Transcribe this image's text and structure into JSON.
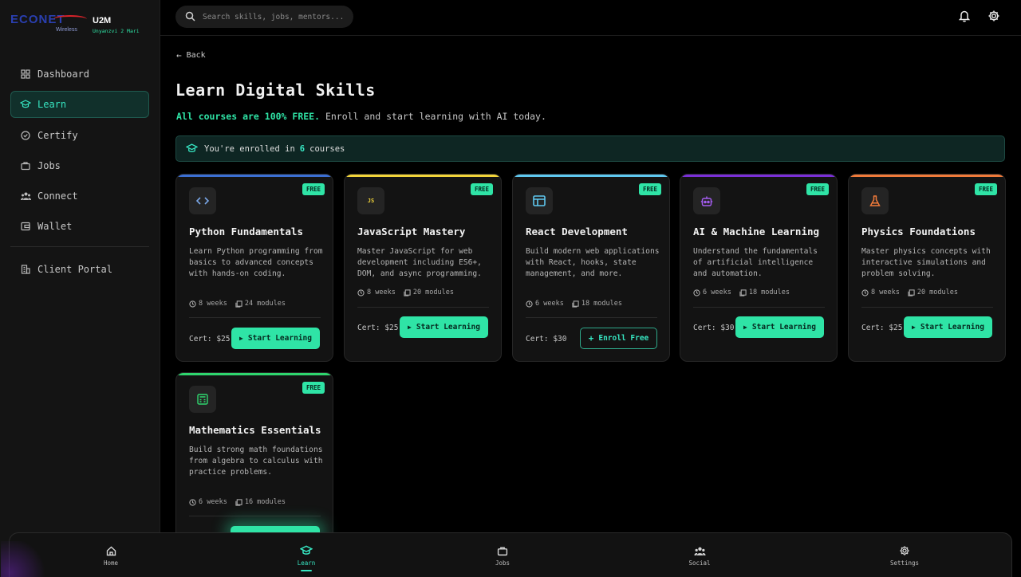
{
  "brand": {
    "logo": "ECONET",
    "logo_sub": "Wireless",
    "app": "U2M",
    "tagline": "Unyanzvi 2 Mari"
  },
  "search": {
    "placeholder": "Search skills, jobs, mentors..."
  },
  "sidebar": {
    "items": [
      {
        "label": "Dashboard",
        "icon": "dashboard-icon"
      },
      {
        "label": "Learn",
        "icon": "graduation-cap-icon",
        "active": true
      },
      {
        "label": "Certify",
        "icon": "badge-check-icon"
      },
      {
        "label": "Jobs",
        "icon": "briefcase-icon"
      },
      {
        "label": "Connect",
        "icon": "users-icon"
      },
      {
        "label": "Wallet",
        "icon": "wallet-icon"
      }
    ],
    "footer_item": {
      "label": "Client Portal",
      "icon": "building-icon"
    }
  },
  "main": {
    "back": "Back",
    "title": "Learn Digital Skills",
    "subtitle_highlight": "All courses are 100% FREE.",
    "subtitle_rest": "Enroll and start learning with AI today.",
    "enrolled_pre": "You're enrolled in",
    "enrolled_count": "6",
    "enrolled_post": "courses"
  },
  "courses": [
    {
      "title": "Python Fundamentals",
      "desc": "Learn Python programming from basics to advanced concepts with hands-on coding.",
      "weeks": "8 weeks",
      "modules": "24 modules",
      "cert": "Cert: $25",
      "button": "Start Learning",
      "badge": "FREE",
      "accent": "#3b6fd4",
      "icon": "code-icon"
    },
    {
      "title": "JavaScript Mastery",
      "desc": "Master JavaScript for web development including ES6+, DOM, and async programming.",
      "weeks": "8 weeks",
      "modules": "20 modules",
      "cert": "Cert: $25",
      "button": "Start Learning",
      "badge": "FREE",
      "accent": "#f2d43a",
      "icon": "js-icon",
      "icon_text": "JS"
    },
    {
      "title": "React Development",
      "desc": "Build modern web applications with React, hooks, state management, and more.",
      "weeks": "6 weeks",
      "modules": "18 modules",
      "cert": "Cert: $30",
      "button": "Enroll Free",
      "badge": "FREE",
      "accent": "#5fc8f0",
      "icon": "browser-window-icon"
    },
    {
      "title": "AI & Machine Learning",
      "desc": "Understand the fundamentals of artificial intelligence and automation.",
      "weeks": "6 weeks",
      "modules": "18 modules",
      "cert": "Cert: $30",
      "button": "Start Learning",
      "badge": "FREE",
      "accent": "#7a2fd8",
      "icon": "robot-icon"
    },
    {
      "title": "Physics Foundations",
      "desc": "Master physics concepts with interactive simulations and problem solving.",
      "weeks": "8 weeks",
      "modules": "20 modules",
      "cert": "Cert: $25",
      "button": "Start Learning",
      "badge": "FREE",
      "accent": "#f07a3a",
      "icon": "flask-icon"
    },
    {
      "title": "Mathematics Essentials",
      "desc": "Build strong math foundations from algebra to calculus with practice problems.",
      "weeks": "6 weeks",
      "modules": "16 modules",
      "badge": "FREE",
      "accent": "#2fd66e",
      "icon": "calculator-icon"
    }
  ],
  "bottomnav": [
    {
      "label": "Home",
      "icon": "home-icon"
    },
    {
      "label": "Learn",
      "icon": "graduation-cap-icon",
      "active": true
    },
    {
      "label": "Jobs",
      "icon": "briefcase-icon"
    },
    {
      "label": "Social",
      "icon": "users-icon"
    },
    {
      "label": "Settings",
      "icon": "gear-icon"
    }
  ],
  "colors": {
    "accent": "#2fe4a6",
    "background": "#000000",
    "sidebar": "#141414",
    "card": "#131313"
  }
}
